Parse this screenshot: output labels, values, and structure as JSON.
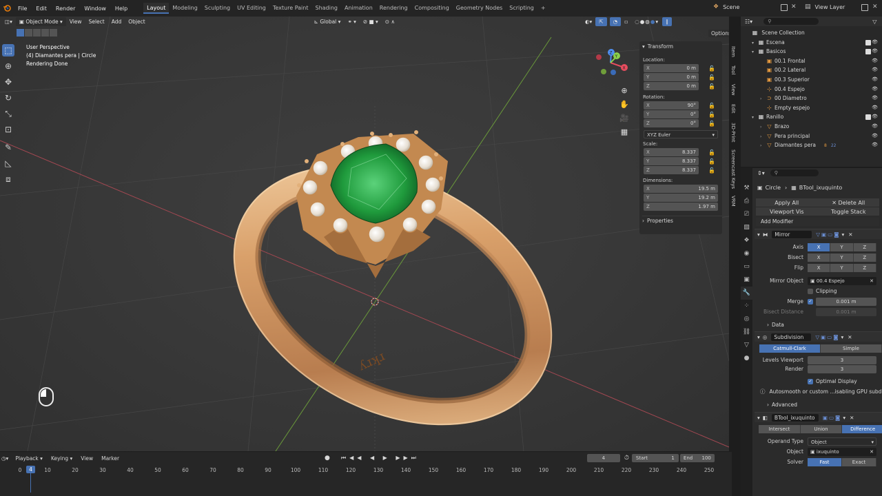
{
  "menu": [
    "File",
    "Edit",
    "Render",
    "Window",
    "Help"
  ],
  "workspaces": [
    {
      "label": "Layout",
      "active": true
    },
    {
      "label": "Modeling",
      "active": false
    },
    {
      "label": "Sculpting",
      "active": false
    },
    {
      "label": "UV Editing",
      "active": false
    },
    {
      "label": "Texture Paint",
      "active": false
    },
    {
      "label": "Shading",
      "active": false
    },
    {
      "label": "Animation",
      "active": false
    },
    {
      "label": "Rendering",
      "active": false
    },
    {
      "label": "Compositing",
      "active": false
    },
    {
      "label": "Geometry Nodes",
      "active": false
    },
    {
      "label": "Scripting",
      "active": false
    }
  ],
  "add_workspace": "+",
  "scene": "Scene",
  "view_layer": "View Layer",
  "header": {
    "mode": "Object Mode",
    "view": "View",
    "select": "Select",
    "add": "Add",
    "object": "Object",
    "orientation": "Global",
    "options": "Options"
  },
  "overlay_text": {
    "perspective": "User Perspective",
    "object": "(4) Diamantes pera | Circle",
    "status": "Rendering Done"
  },
  "engraving": "ʎɹʞɹ",
  "transform": {
    "title": "Transform",
    "location_label": "Location:",
    "location": [
      {
        "axis": "X",
        "value": "0 m"
      },
      {
        "axis": "Y",
        "value": "0 m"
      },
      {
        "axis": "Z",
        "value": "0 m"
      }
    ],
    "rotation_label": "Rotation:",
    "rotation": [
      {
        "axis": "X",
        "value": "90°"
      },
      {
        "axis": "Y",
        "value": "0°"
      },
      {
        "axis": "Z",
        "value": "0°"
      }
    ],
    "rotation_mode": "XYZ Euler",
    "scale_label": "Scale:",
    "scale": [
      {
        "axis": "X",
        "value": "8.337"
      },
      {
        "axis": "Y",
        "value": "8.337"
      },
      {
        "axis": "Z",
        "value": "8.337"
      }
    ],
    "dimensions_label": "Dimensions:",
    "dimensions": [
      {
        "axis": "X",
        "value": "19.5 m"
      },
      {
        "axis": "Y",
        "value": "19.2 m"
      },
      {
        "axis": "Z",
        "value": "1.97 m"
      }
    ],
    "properties": "Properties"
  },
  "side_tabs": [
    "Item",
    "Tool",
    "View",
    "Edit",
    "3D-Print",
    "Screencast Keys",
    "VRM"
  ],
  "outliner": {
    "root": "Scene Collection",
    "rows": [
      {
        "label": "Escena",
        "indent": 1,
        "icon": "collection-icon",
        "color": "#e0e0e0"
      },
      {
        "label": "Basicos",
        "indent": 1,
        "icon": "collection-icon",
        "color": "#e0e0e0"
      },
      {
        "label": "00.1 Frontal",
        "indent": 2,
        "icon": "camera-icon",
        "color": "#e69a3f"
      },
      {
        "label": "00.2 Lateral",
        "indent": 2,
        "icon": "camera-icon",
        "color": "#e69a3f"
      },
      {
        "label": "00.3 Superior",
        "indent": 2,
        "icon": "camera-icon",
        "color": "#e69a3f"
      },
      {
        "label": "00.4 Espejo",
        "indent": 2,
        "icon": "empty-icon",
        "color": "#e69a3f"
      },
      {
        "label": "00 Diametro",
        "indent": 2,
        "icon": "curve-icon",
        "color": "#e69a3f"
      },
      {
        "label": "Empty espejo",
        "indent": 2,
        "icon": "empty-icon",
        "color": "#e69a3f"
      },
      {
        "label": "Ranillo",
        "indent": 1,
        "icon": "collection-icon",
        "color": "#e0e0e0"
      },
      {
        "label": "Brazo",
        "indent": 2,
        "icon": "mesh-icon",
        "color": "#e69a3f"
      },
      {
        "label": "Pera principal",
        "indent": 2,
        "icon": "mesh-icon",
        "color": "#e69a3f"
      },
      {
        "label": "Diamantes pera",
        "indent": 2,
        "icon": "mesh-icon",
        "color": "#e69a3f"
      }
    ],
    "badge_a": "8",
    "badge_b": "22"
  },
  "properties": {
    "breadcrumb_object": "Circle",
    "breadcrumb_modifier": "BTool_ixuquinto",
    "apply_all": "Apply All",
    "delete_all": "Delete All",
    "viewport_vis": "Viewport Vis",
    "toggle_stack": "Toggle Stack",
    "add_modifier": "Add Modifier",
    "mirror": {
      "name": "Mirror",
      "axis_label": "Axis",
      "bisect_label": "Bisect",
      "flip_label": "Flip",
      "axes": [
        "X",
        "Y",
        "Z"
      ],
      "mirror_object_label": "Mirror Object",
      "mirror_object": "00.4 Espejo",
      "clipping": "Clipping",
      "merge_label": "Merge",
      "merge_value": "0.001 m",
      "bisect_distance_label": "Bisect Distance",
      "bisect_distance": "0.001 m",
      "data": "Data"
    },
    "subdivision": {
      "name": "Subdivision",
      "catmull": "Catmull-Clark",
      "simple": "Simple",
      "levels_viewport_label": "Levels Viewport",
      "levels_viewport": "3",
      "render_label": "Render",
      "render": "3",
      "optimal_display": "Optimal Display",
      "warning": "Autosmooth or custom ...isabling GPU subdivisi",
      "advanced": "Advanced"
    },
    "boolean": {
      "name": "BTool_ixuquinto",
      "intersect": "Intersect",
      "union": "Union",
      "difference": "Difference",
      "operand_type_label": "Operand Type",
      "operand_type": "Object",
      "object_label": "Object",
      "object": "ixuquinto",
      "solver_label": "Solver",
      "fast": "Fast",
      "exact": "Exact"
    }
  },
  "timeline": {
    "playback": "Playback",
    "keying": "Keying",
    "view": "View",
    "marker": "Marker",
    "current_frame": "4",
    "start_label": "Start",
    "start": "1",
    "end_label": "End",
    "end": "100",
    "ticks": [
      "0",
      "10",
      "20",
      "30",
      "40",
      "50",
      "60",
      "70",
      "80",
      "90",
      "100",
      "110",
      "120",
      "130",
      "140",
      "150",
      "160",
      "170",
      "180",
      "190",
      "200",
      "210",
      "220",
      "230",
      "240",
      "250"
    ],
    "playhead": "4"
  },
  "colors": {
    "accent": "#4772b3",
    "gold": "#d9a06a",
    "emerald": "#1f9a3c",
    "x_axis": "#e84d5f",
    "y_axis": "#8bd14b",
    "z_axis": "#4f8ff0"
  }
}
